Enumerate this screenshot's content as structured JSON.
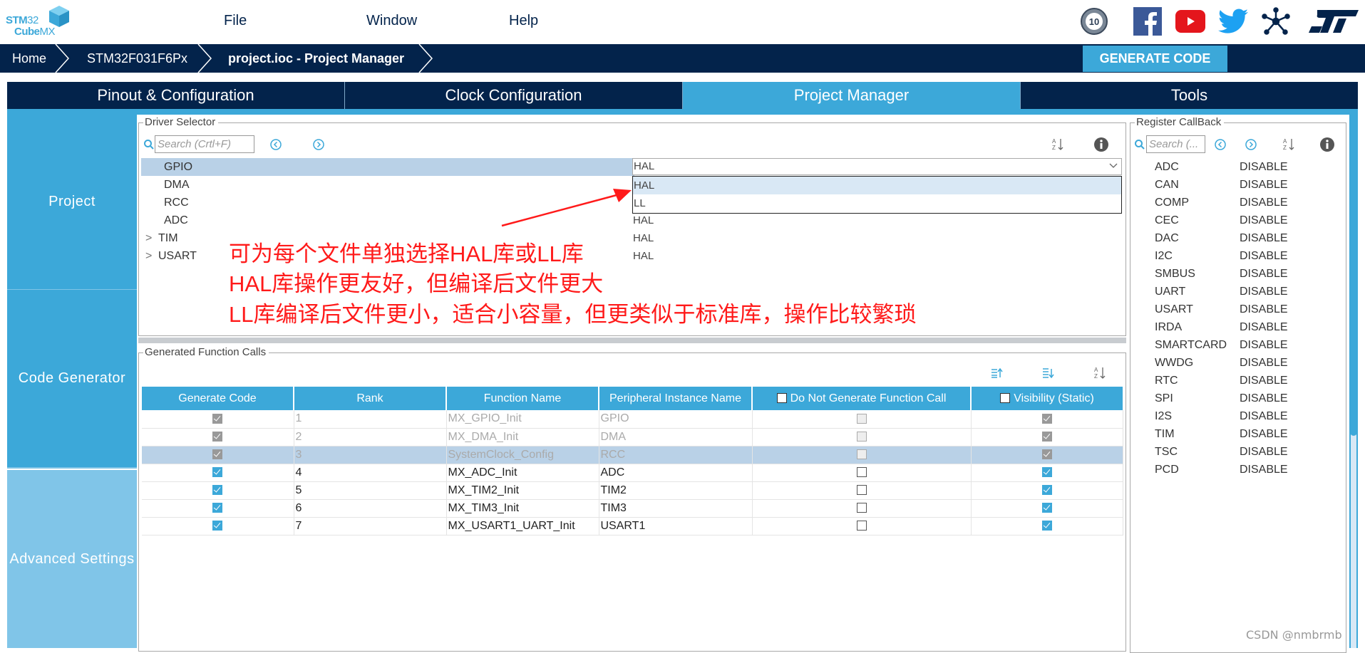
{
  "app": {
    "logo_line1_bold": "STM",
    "logo_line1_thin": "32",
    "logo_line2_bold": "Cube",
    "logo_line2_thin": "MX"
  },
  "menu": [
    "File",
    "Window",
    "Help"
  ],
  "social_icons": [
    "anniversary-10-years-icon",
    "facebook-icon",
    "youtube-icon",
    "twitter-icon",
    "network-icon",
    "st-logo-icon"
  ],
  "breadcrumb": [
    "Home",
    "STM32F031F6Px",
    "project.ioc - Project Manager"
  ],
  "generate_button": "GENERATE CODE",
  "tabs": [
    {
      "label": "Pinout & Configuration",
      "active": false
    },
    {
      "label": "Clock Configuration",
      "active": false
    },
    {
      "label": "Project Manager",
      "active": true
    },
    {
      "label": "Tools",
      "active": false
    }
  ],
  "sidebar": [
    {
      "label": "Project"
    },
    {
      "label": "Code Generator"
    },
    {
      "label": "Advanced Settings"
    }
  ],
  "driver_selector": {
    "title": "Driver Selector",
    "search_placeholder": "Search (Crtl+F)",
    "rows": [
      {
        "name": "GPIO",
        "value": "HAL",
        "expandable": false,
        "selected": true
      },
      {
        "name": "DMA",
        "value": "HAL",
        "expandable": false
      },
      {
        "name": "RCC",
        "value": "HAL",
        "expandable": false
      },
      {
        "name": "ADC",
        "value": "HAL",
        "expandable": false
      },
      {
        "name": "TIM",
        "value": "HAL",
        "expandable": true
      },
      {
        "name": "USART",
        "value": "HAL",
        "expandable": true
      }
    ],
    "combo_value": "HAL",
    "dropdown_options": [
      "HAL",
      "LL"
    ],
    "dropdown_highlighted": "HAL"
  },
  "annotation": {
    "lines": [
      "可为每个文件单独选择HAL库或LL库",
      "HAL库操作更友好，但编译后文件更大",
      "LL库编译后文件更小，适合小容量，但更类似于标准库，操作比较繁琐"
    ],
    "color": "#ff1a1a"
  },
  "generated_function_calls": {
    "title": "Generated Function Calls",
    "columns": [
      "Generate Code",
      "Rank",
      "Function Name",
      "Peripheral Instance Name",
      "Do Not Generate Function Call",
      "Visibility (Static)"
    ],
    "rows": [
      {
        "generate": true,
        "rank": "1",
        "function": "MX_GPIO_Init",
        "peripheral": "GPIO",
        "do_not_generate": false,
        "static": true,
        "disabled": true,
        "selected": false
      },
      {
        "generate": true,
        "rank": "2",
        "function": "MX_DMA_Init",
        "peripheral": "DMA",
        "do_not_generate": false,
        "static": true,
        "disabled": true,
        "selected": false
      },
      {
        "generate": true,
        "rank": "3",
        "function": "SystemClock_Config",
        "peripheral": "RCC",
        "do_not_generate": false,
        "static": true,
        "disabled": true,
        "selected": true
      },
      {
        "generate": true,
        "rank": "4",
        "function": "MX_ADC_Init",
        "peripheral": "ADC",
        "do_not_generate": false,
        "static": true,
        "disabled": false,
        "selected": false
      },
      {
        "generate": true,
        "rank": "5",
        "function": "MX_TIM2_Init",
        "peripheral": "TIM2",
        "do_not_generate": false,
        "static": true,
        "disabled": false,
        "selected": false
      },
      {
        "generate": true,
        "rank": "6",
        "function": "MX_TIM3_Init",
        "peripheral": "TIM3",
        "do_not_generate": false,
        "static": true,
        "disabled": false,
        "selected": false
      },
      {
        "generate": true,
        "rank": "7",
        "function": "MX_USART1_UART_Init",
        "peripheral": "USART1",
        "do_not_generate": false,
        "static": true,
        "disabled": false,
        "selected": false
      }
    ]
  },
  "register_callback": {
    "title": "Register CallBack",
    "search_placeholder": "Search (...",
    "rows": [
      {
        "name": "ADC",
        "value": "DISABLE"
      },
      {
        "name": "CAN",
        "value": "DISABLE"
      },
      {
        "name": "COMP",
        "value": "DISABLE"
      },
      {
        "name": "CEC",
        "value": "DISABLE"
      },
      {
        "name": "DAC",
        "value": "DISABLE"
      },
      {
        "name": "I2C",
        "value": "DISABLE"
      },
      {
        "name": "SMBUS",
        "value": "DISABLE"
      },
      {
        "name": "UART",
        "value": "DISABLE"
      },
      {
        "name": "USART",
        "value": "DISABLE"
      },
      {
        "name": "IRDA",
        "value": "DISABLE"
      },
      {
        "name": "SMARTCARD",
        "value": "DISABLE"
      },
      {
        "name": "WWDG",
        "value": "DISABLE"
      },
      {
        "name": "RTC",
        "value": "DISABLE"
      },
      {
        "name": "SPI",
        "value": "DISABLE"
      },
      {
        "name": "I2S",
        "value": "DISABLE"
      },
      {
        "name": "TIM",
        "value": "DISABLE"
      },
      {
        "name": "TSC",
        "value": "DISABLE"
      },
      {
        "name": "PCD",
        "value": "DISABLE"
      }
    ]
  },
  "watermark": "CSDN @nmbrmb",
  "colors": {
    "navy": "#03234b",
    "accent": "#3ca8d9",
    "sidebar_light": "#80c5e8",
    "selection": "#b9d1e7"
  }
}
